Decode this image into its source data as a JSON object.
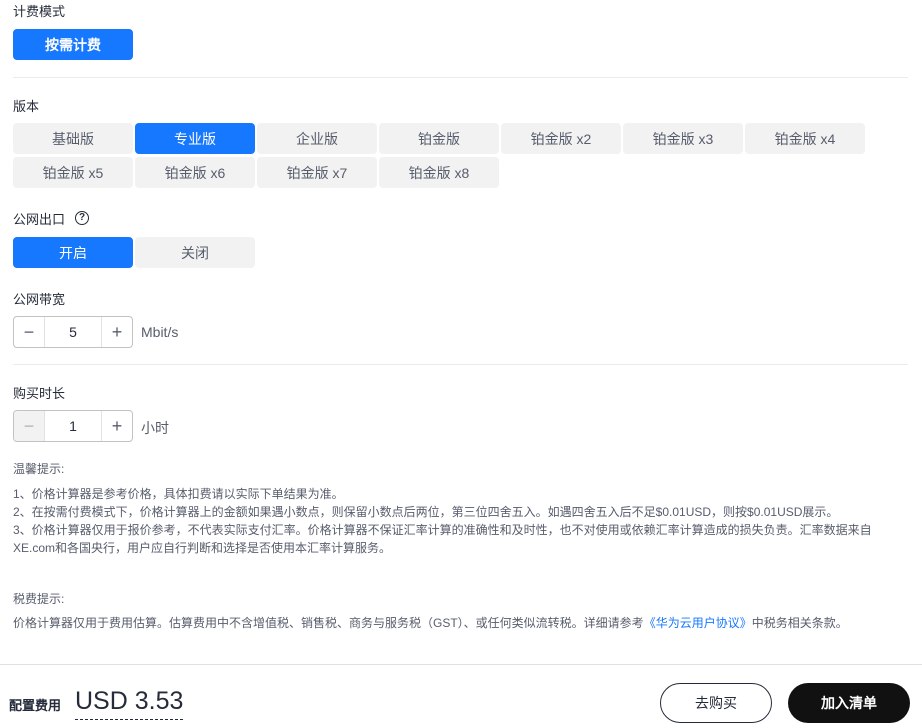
{
  "billing": {
    "label": "计费模式",
    "option": "按需计费"
  },
  "edition": {
    "label": "版本",
    "options": [
      "基础版",
      "专业版",
      "企业版",
      "铂金版",
      "铂金版 x2",
      "铂金版 x3",
      "铂金版 x4",
      "铂金版 x5",
      "铂金版 x6",
      "铂金版 x7",
      "铂金版 x8"
    ],
    "selected": "专业版"
  },
  "public_egress": {
    "label": "公网出口",
    "help_icon": "question-circle-icon",
    "options": [
      "开启",
      "关闭"
    ],
    "selected": "开启"
  },
  "bandwidth": {
    "label": "公网带宽",
    "value": "5",
    "unit": "Mbit/s"
  },
  "duration": {
    "label": "购买时长",
    "value": "1",
    "unit": "小时"
  },
  "tips": {
    "title": "温馨提示:",
    "lines": [
      "1、价格计算器是参考价格，具体扣费请以实际下单结果为准。",
      "2、在按需付费模式下，价格计算器上的金额如果遇小数点，则保留小数点后两位，第三位四舍五入。如遇四舍五入后不足$0.01USD，则按$0.01USD展示。",
      "3、价格计算器仅用于报价参考，不代表实际支付汇率。价格计算器不保证汇率计算的准确性和及时性，也不对使用或依赖汇率计算造成的损失负责。汇率数据来自",
      "XE.com和各国央行，用户应自行判断和选择是否使用本汇率计算服务。"
    ]
  },
  "tax": {
    "title": "税费提示:",
    "text_before": "价格计算器仅用于费用估算。估算费用中不含增值税、销售税、商务与服务税（GST）、或任何类似流转税。详细请参考",
    "link": "《华为云用户协议》",
    "text_after": "中税务相关条款。"
  },
  "footer": {
    "price_label": "配置费用",
    "price_value": "USD 3.53",
    "buy_now": "去购买",
    "add_to_list": "加入清单"
  },
  "colors": {
    "accent": "#1677ff",
    "option_bg": "#f2f2f2",
    "dark_button": "#111111"
  }
}
